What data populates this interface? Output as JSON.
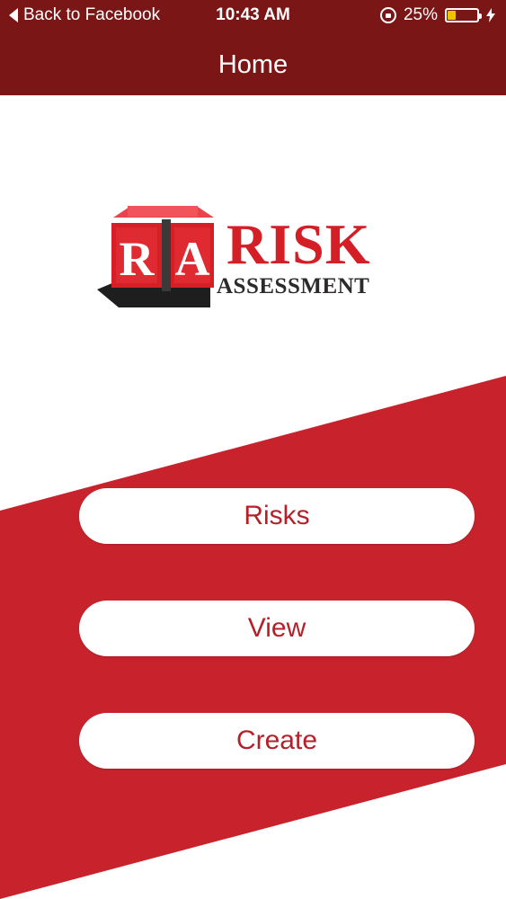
{
  "status_bar": {
    "back_label": "Back to Facebook",
    "time": "10:43 AM",
    "battery_percent": "25%",
    "battery_level": 0.25
  },
  "nav": {
    "title": "Home"
  },
  "logo": {
    "block_letters": [
      "R",
      "A"
    ],
    "word_main": "RISK",
    "word_sub": "ASSESSMENT"
  },
  "menu": {
    "risks_label": "Risks",
    "view_label": "View",
    "create_label": "Create"
  },
  "colors": {
    "header": "#7a1616",
    "accent_red": "#c8232c",
    "button_text": "#b52029",
    "battery": "#f2c200"
  }
}
